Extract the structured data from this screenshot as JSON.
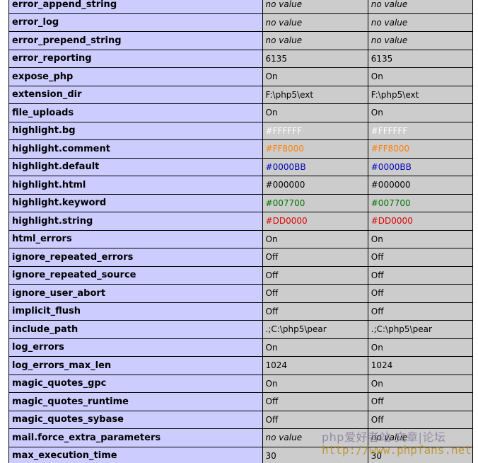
{
  "directives": [
    {
      "name": "error_append_string",
      "local": "no value",
      "master": "no value",
      "no_value": true
    },
    {
      "name": "error_log",
      "local": "no value",
      "master": "no value",
      "no_value": true
    },
    {
      "name": "error_prepend_string",
      "local": "no value",
      "master": "no value",
      "no_value": true
    },
    {
      "name": "error_reporting",
      "local": "6135",
      "master": "6135"
    },
    {
      "name": "expose_php",
      "local": "On",
      "master": "On"
    },
    {
      "name": "extension_dir",
      "local": "F:\\php5\\ext",
      "master": "F:\\php5\\ext"
    },
    {
      "name": "file_uploads",
      "local": "On",
      "master": "On"
    },
    {
      "name": "highlight.bg",
      "local": "#FFFFFF",
      "master": "#FFFFFF",
      "color": "#FFFFFF"
    },
    {
      "name": "highlight.comment",
      "local": "#FF8000",
      "master": "#FF8000",
      "color": "#FF8000"
    },
    {
      "name": "highlight.default",
      "local": "#0000BB",
      "master": "#0000BB",
      "color": "#0000BB"
    },
    {
      "name": "highlight.html",
      "local": "#000000",
      "master": "#000000",
      "color": "#000000"
    },
    {
      "name": "highlight.keyword",
      "local": "#007700",
      "master": "#007700",
      "color": "#007700"
    },
    {
      "name": "highlight.string",
      "local": "#DD0000",
      "master": "#DD0000",
      "color": "#DD0000"
    },
    {
      "name": "html_errors",
      "local": "On",
      "master": "On"
    },
    {
      "name": "ignore_repeated_errors",
      "local": "Off",
      "master": "Off"
    },
    {
      "name": "ignore_repeated_source",
      "local": "Off",
      "master": "Off"
    },
    {
      "name": "ignore_user_abort",
      "local": "Off",
      "master": "Off"
    },
    {
      "name": "implicit_flush",
      "local": "Off",
      "master": "Off"
    },
    {
      "name": "include_path",
      "local": ".;C:\\php5\\pear",
      "master": ".;C:\\php5\\pear"
    },
    {
      "name": "log_errors",
      "local": "On",
      "master": "On"
    },
    {
      "name": "log_errors_max_len",
      "local": "1024",
      "master": "1024"
    },
    {
      "name": "magic_quotes_gpc",
      "local": "On",
      "master": "On"
    },
    {
      "name": "magic_quotes_runtime",
      "local": "Off",
      "master": "Off"
    },
    {
      "name": "magic_quotes_sybase",
      "local": "Off",
      "master": "Off"
    },
    {
      "name": "mail.force_extra_parameters",
      "local": "no value",
      "master": "no value",
      "no_value": true
    },
    {
      "name": "max_execution_time",
      "local": "30",
      "master": "30"
    }
  ],
  "theme": {
    "key_column_bg": "#CCCCFF",
    "value_column_bg": "#CCCCCC",
    "border": "#000000"
  },
  "watermark": {
    "line1": "php爱好者站 文章|论坛",
    "line2": "http://www.phpfans.net"
  }
}
